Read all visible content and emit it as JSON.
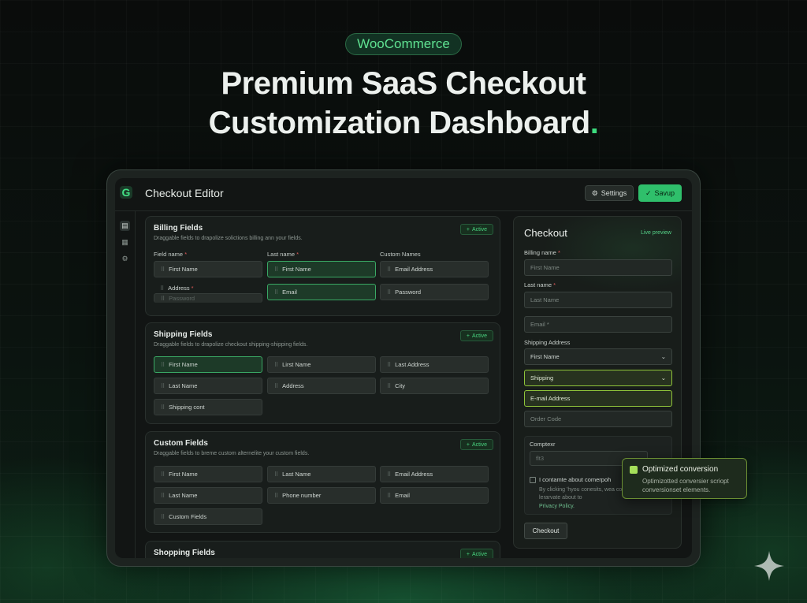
{
  "hero": {
    "pill": "WooCommerce",
    "line1": "Premium SaaS Checkout",
    "line2": "Customization Dashboard",
    "dot": "."
  },
  "app": {
    "logo_glyph": "G",
    "title": "Checkout Editor",
    "settings_label": "Settings",
    "save_label": "Savup",
    "accent": "#2fbf6b"
  },
  "sidebar": {
    "items": [
      {
        "icon": "layout-icon",
        "glyph": "▤"
      },
      {
        "icon": "columns-icon",
        "glyph": "▦"
      },
      {
        "icon": "gear-icon",
        "glyph": "⚙"
      }
    ]
  },
  "sections": {
    "billing": {
      "title": "Billing Fields",
      "desc": "Draggable fields to drapolize solictions billing ann your fields.",
      "badge": "Active",
      "col1": "Field name",
      "col2": "Last name",
      "col3": "Custom Names",
      "fields": [
        "First Name",
        "First Name",
        "Email Address",
        "Address",
        "Email",
        "Password",
        "Password"
      ]
    },
    "shipping": {
      "title": "Shipping Fields",
      "desc": "Draggable fields to drapolize checkout shipping-shipping fields.",
      "badge": "Active",
      "fields": [
        "First Name",
        "Lirst Name",
        "Last Address",
        "Last Name",
        "Address",
        "City",
        "Shipping cont"
      ]
    },
    "custom": {
      "title": "Custom Fields",
      "desc": "Draggable fields to breme custom alternelite your custom fields.",
      "badge": "Active",
      "fields": [
        "First Name",
        "Last Name",
        "Email Address",
        "Last Name",
        "Phone number",
        "Email",
        "Custom Fields"
      ]
    },
    "shopping": {
      "title": "Shopping Fields",
      "badge": "Active"
    }
  },
  "preview": {
    "title": "Checkout",
    "live": "Live preview",
    "billing_label": "Billing name",
    "first_placeholder": "First Name",
    "last_label": "Last name",
    "last_placeholder": "Last Name",
    "email_placeholder": "Email *",
    "shipping_label": "Shipping Address",
    "select1": "First Name",
    "select2": "Shipping",
    "email_addr": "E-mail Address",
    "order_code": "Order Code",
    "compact_label": "Comptexr",
    "compact_value": "flt3",
    "consent": "I contamte about comerpoh",
    "consent_small": "By clicking 'hyou conesits, wea conversion to lerarvate about to",
    "privacy": "Privacy Policy.",
    "checkout_btn": "Checkout"
  },
  "tooltip": {
    "title": "Optimized conversion",
    "body": "Optimizotted conversier scriopt conversionset elements."
  }
}
